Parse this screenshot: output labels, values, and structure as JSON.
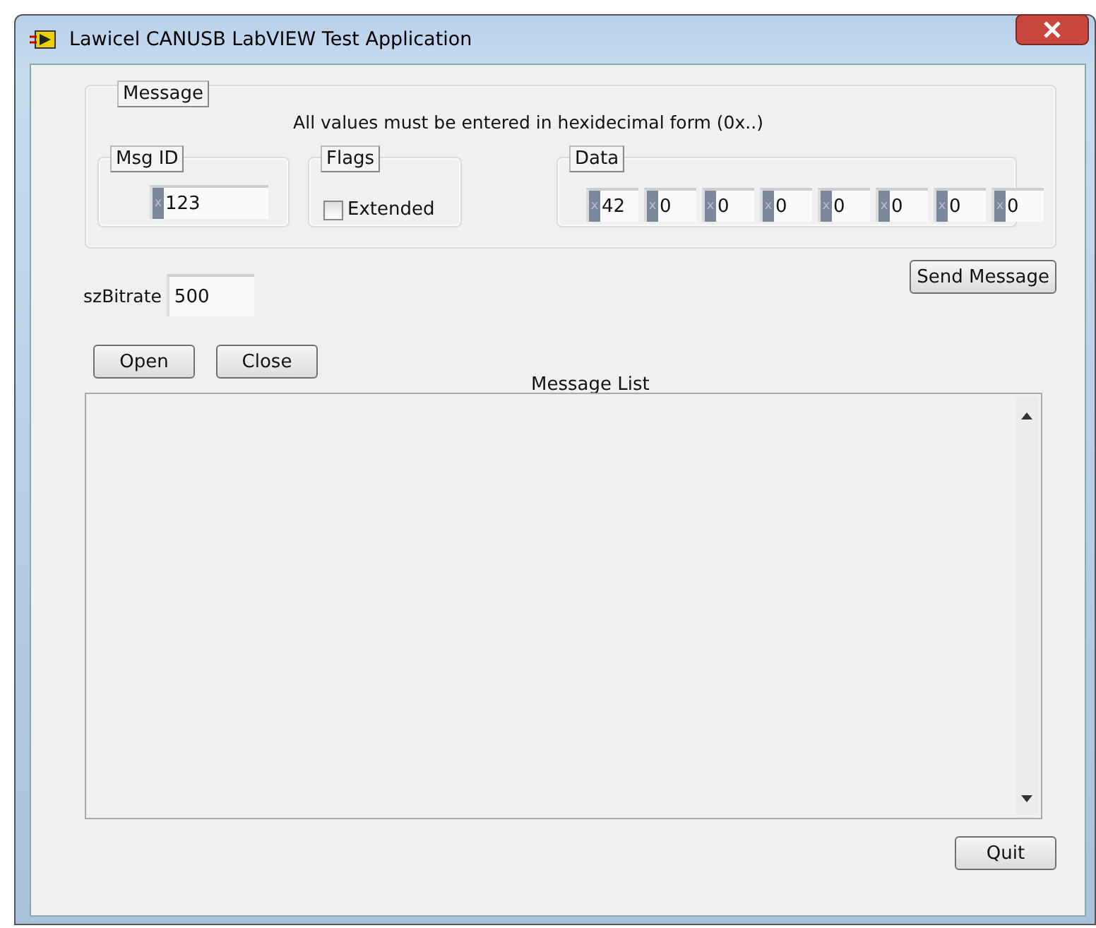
{
  "window": {
    "title": "Lawicel CANUSB LabVIEW Test Application"
  },
  "message": {
    "label": "Message",
    "note": "All values must be entered in hexidecimal form (0x..)",
    "msg_id": {
      "label": "Msg ID",
      "radix": "x",
      "value": "123"
    },
    "flags": {
      "label": "Flags",
      "extended": {
        "label": "Extended",
        "checked": false
      }
    },
    "data": {
      "label": "Data",
      "bytes": [
        {
          "radix": "x",
          "value": "42"
        },
        {
          "radix": "x",
          "value": "0"
        },
        {
          "radix": "x",
          "value": "0"
        },
        {
          "radix": "x",
          "value": "0"
        },
        {
          "radix": "x",
          "value": "0"
        },
        {
          "radix": "x",
          "value": "0"
        },
        {
          "radix": "x",
          "value": "0"
        },
        {
          "radix": "x",
          "value": "0"
        }
      ]
    }
  },
  "bitrate": {
    "label": "szBitrate",
    "value": "500"
  },
  "buttons": {
    "send": "Send Message",
    "open": "Open",
    "close": "Close",
    "quit": "Quit"
  },
  "message_list": {
    "label": "Message List"
  }
}
